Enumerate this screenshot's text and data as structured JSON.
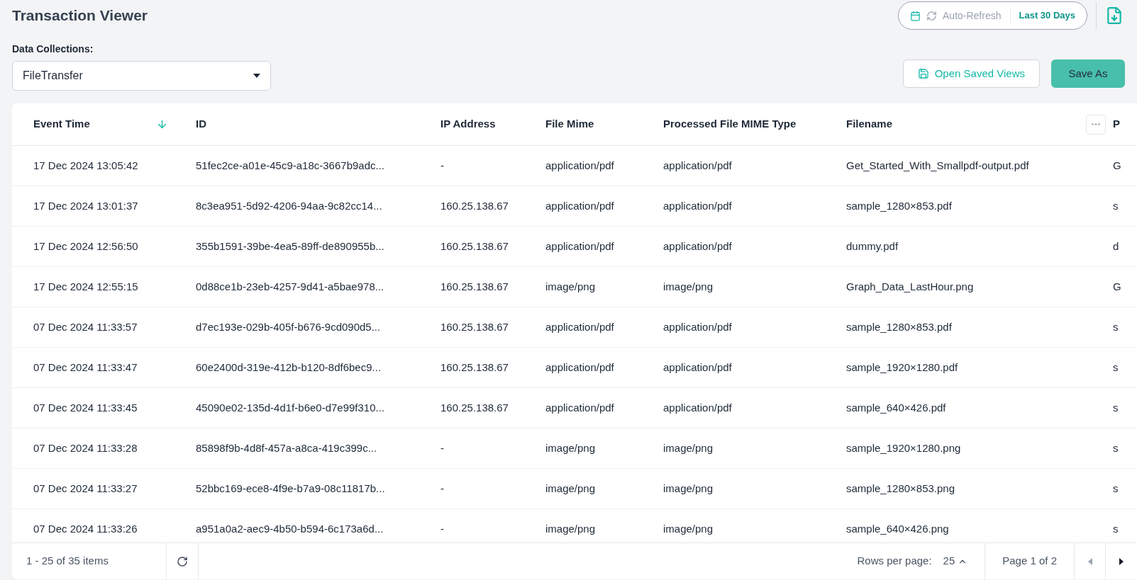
{
  "title": "Transaction Viewer",
  "header": {
    "auto_refresh": "Auto-Refresh",
    "range": "Last 30 Days"
  },
  "collection": {
    "label": "Data Collections:",
    "value": "FileTransfer"
  },
  "actions": {
    "open_views": "Open Saved Views",
    "save_as": "Save As"
  },
  "table": {
    "columns": [
      {
        "label": "Event Time",
        "sorted": true
      },
      {
        "label": "ID",
        "sorted": false
      },
      {
        "label": "IP Address",
        "sorted": false
      },
      {
        "label": "File Mime",
        "sorted": false
      },
      {
        "label": "Processed File MIME Type",
        "sorted": false
      },
      {
        "label": "Filename",
        "sorted": false
      },
      {
        "label": "P",
        "sorted": false
      }
    ],
    "rows": [
      [
        "17 Dec 2024 13:05:42",
        "51fec2ce-a01e-45c9-a18c-3667b9adc...",
        "-",
        "application/pdf",
        "application/pdf",
        "Get_Started_With_Smallpdf-output.pdf",
        "G"
      ],
      [
        "17 Dec 2024 13:01:37",
        "8c3ea951-5d92-4206-94aa-9c82cc14...",
        "160.25.138.67",
        "application/pdf",
        "application/pdf",
        "sample_1280×853.pdf",
        "s"
      ],
      [
        "17 Dec 2024 12:56:50",
        "355b1591-39be-4ea5-89ff-de890955b...",
        "160.25.138.67",
        "application/pdf",
        "application/pdf",
        "dummy.pdf",
        "d"
      ],
      [
        "17 Dec 2024 12:55:15",
        "0d88ce1b-23eb-4257-9d41-a5bae978...",
        "160.25.138.67",
        "image/png",
        "image/png",
        "Graph_Data_LastHour.png",
        "G"
      ],
      [
        "07 Dec 2024 11:33:57",
        "d7ec193e-029b-405f-b676-9cd090d5...",
        "160.25.138.67",
        "application/pdf",
        "application/pdf",
        "sample_1280×853.pdf",
        "s"
      ],
      [
        "07 Dec 2024 11:33:47",
        "60e2400d-319e-412b-b120-8df6bec9...",
        "160.25.138.67",
        "application/pdf",
        "application/pdf",
        "sample_1920×1280.pdf",
        "s"
      ],
      [
        "07 Dec 2024 11:33:45",
        "45090e02-135d-4d1f-b6e0-d7e99f310...",
        "160.25.138.67",
        "application/pdf",
        "application/pdf",
        "sample_640×426.pdf",
        "s"
      ],
      [
        "07 Dec 2024 11:33:28",
        "85898f9b-4d8f-457a-a8ca-419c399c...",
        "-",
        "image/png",
        "image/png",
        "sample_1920×1280.png",
        "s"
      ],
      [
        "07 Dec 2024 11:33:27",
        "52bbc169-ece8-4f9e-b7a9-08c11817b...",
        "-",
        "image/png",
        "image/png",
        "sample_1280×853.png",
        "s"
      ],
      [
        "07 Dec 2024 11:33:26",
        "a951a0a2-aec9-4b50-b594-6c173a6d...",
        "-",
        "image/png",
        "image/png",
        "sample_640×426.png",
        "s"
      ]
    ]
  },
  "footer": {
    "items": "1 - 25 of 35 items",
    "rows_label": "Rows per page:",
    "rows_value": "25",
    "page": "Page 1 of 2"
  }
}
